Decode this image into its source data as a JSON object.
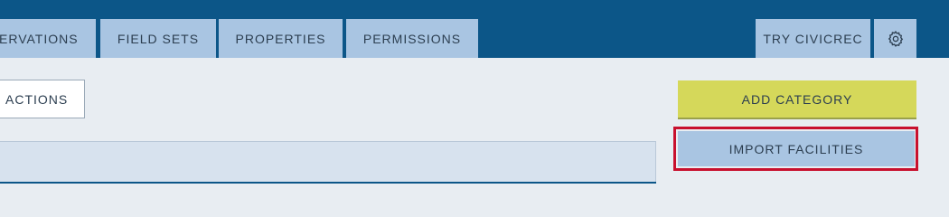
{
  "nav": {
    "tabs": [
      {
        "label": "ERVATIONS"
      },
      {
        "label": "FIELD SETS"
      },
      {
        "label": "PROPERTIES"
      },
      {
        "label": "PERMISSIONS"
      }
    ],
    "try_label": "TRY CIVICREC",
    "settings_icon": "gear-icon"
  },
  "toolbar": {
    "actions_label": "ACTIONS",
    "add_category_label": "ADD CATEGORY",
    "import_facilities_label": "IMPORT FACILITIES"
  },
  "colors": {
    "header_bg": "#0c5688",
    "tab_bg": "#a9c5e2",
    "page_bg": "#e8edf2",
    "add_button_bg": "#d5d85a",
    "highlight": "#c8102e"
  }
}
